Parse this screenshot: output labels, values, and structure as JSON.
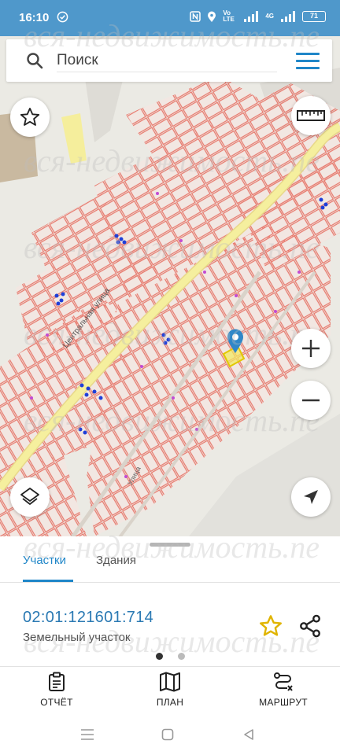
{
  "status_bar": {
    "time": "16:10",
    "volte": "Vo LTE",
    "network": "4G",
    "battery": "71"
  },
  "search": {
    "placeholder": "Поиск"
  },
  "map": {
    "street_label": "Центральная улица",
    "street_label_2": "Улица",
    "watermark": "вся-недвижимость.ne"
  },
  "tabs": {
    "active": "Участки",
    "inactive": "Здания"
  },
  "parcel": {
    "id": "02:01:121601:714",
    "type": "Земельный участок"
  },
  "actions": {
    "report": "ОТЧЁТ",
    "plan": "ПЛАН",
    "route": "МАРШРУТ"
  },
  "colors": {
    "accent": "#1f86c8",
    "status_bar": "#4f98cb",
    "parcel_outline": "#e8776b",
    "road": "#f2ec98",
    "star": "#e0b400"
  },
  "icons": {
    "search": "search-icon",
    "menu": "menu-icon",
    "favorite": "star-icon",
    "ruler": "ruler-icon",
    "zoom_in": "plus-icon",
    "zoom_out": "minus-icon",
    "layers": "layers-icon",
    "location": "navigation-arrow-icon",
    "share": "share-icon",
    "report": "clipboard-icon",
    "plan": "map-icon",
    "route": "route-icon"
  }
}
